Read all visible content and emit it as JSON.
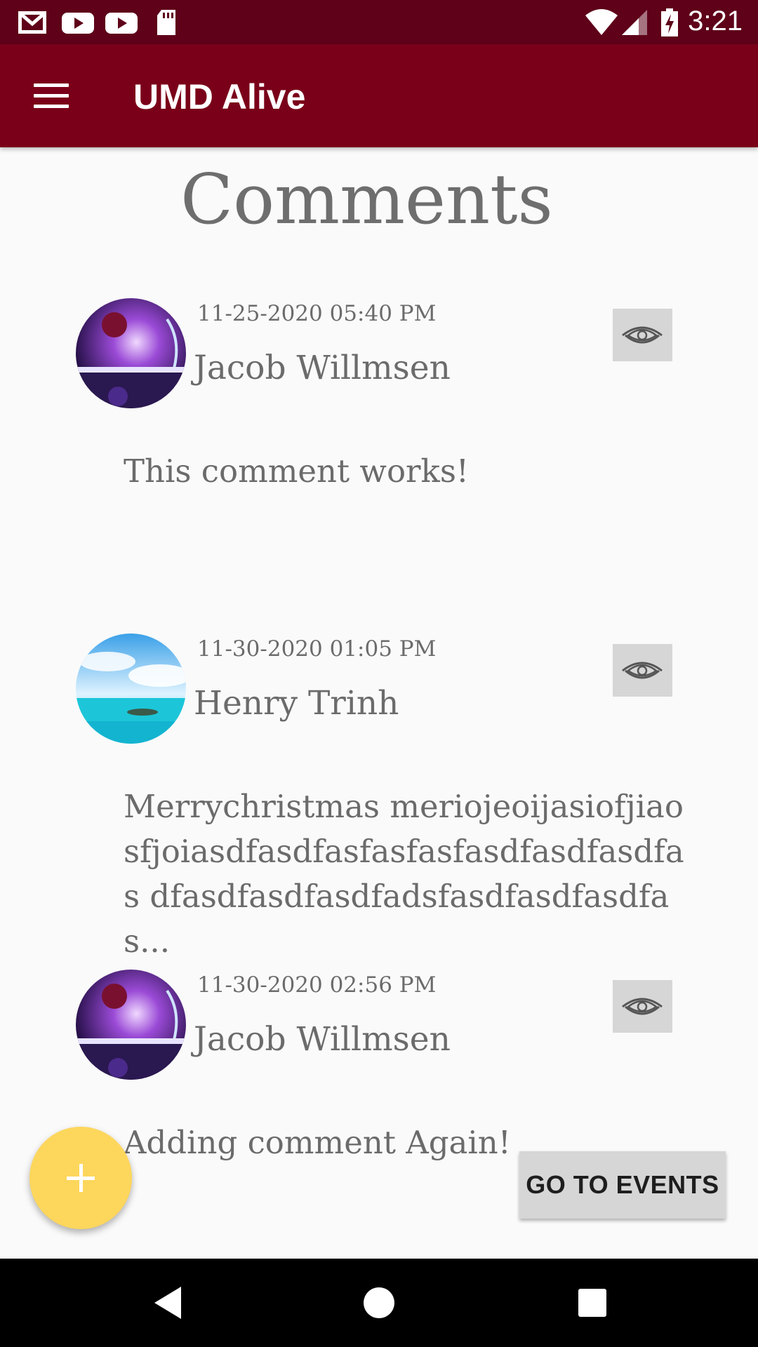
{
  "status_bar": {
    "time": "3:21",
    "icons": [
      "gmail-icon",
      "youtube-icon",
      "youtube-icon",
      "sd-card-icon",
      "wifi-icon",
      "signal-icon",
      "battery-charging-icon"
    ]
  },
  "app_bar": {
    "title": "UMD Alive",
    "menu_icon": "hamburger-menu-icon"
  },
  "page": {
    "title": "Comments"
  },
  "comments": [
    {
      "timestamp": "11-25-2020 05:40 PM",
      "author": "Jacob Willmsen",
      "text": "This comment works!",
      "avatar": "space-nebula-avatar",
      "view_icon": "eye-icon"
    },
    {
      "timestamp": "11-30-2020 01:05 PM",
      "author": "Henry Trinh",
      "text": "Merrychristmas meriojeoijasiofjiao sfjoiasdfasdfasfasfasfasdfasdfasdfas dfasdfasdfasdfadsfasdfasdfasdfas...",
      "avatar": "tropical-sea-avatar",
      "view_icon": "eye-icon"
    },
    {
      "timestamp": "11-30-2020 02:56 PM",
      "author": "Jacob Willmsen",
      "text": "Adding comment Again!",
      "avatar": "space-nebula-avatar",
      "view_icon": "eye-icon"
    }
  ],
  "fab": {
    "icon": "plus-icon"
  },
  "events_button": {
    "label": "GO TO EVENTS"
  },
  "colors": {
    "status_bar": "#5e0119",
    "app_bar": "#7a0019",
    "fab": "#fdd65c",
    "button_gray": "#d6d6d6",
    "text_gray": "#6b6b6b"
  }
}
